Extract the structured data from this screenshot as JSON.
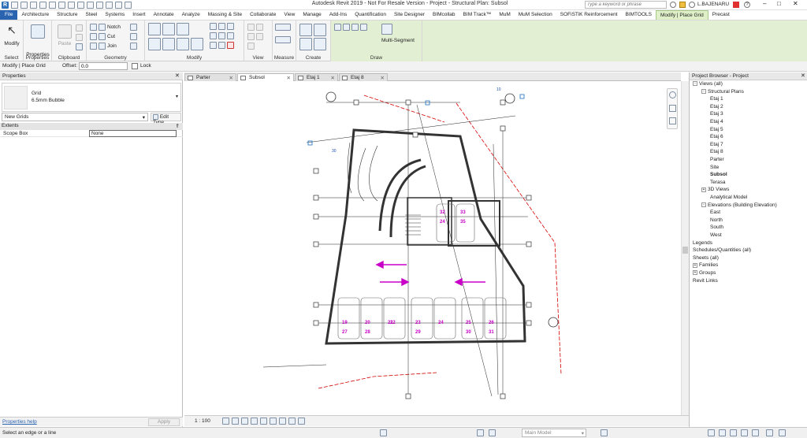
{
  "window": {
    "title": "Autodesk Revit 2019 - Not For Resale Version - Project - Structural Plan: Subsol"
  },
  "search": {
    "placeholder": "Type a keyword or phrase"
  },
  "user": {
    "name": "L.BAJENARU"
  },
  "tabs": [
    "File",
    "Architecture",
    "Structure",
    "Steel",
    "Systems",
    "Insert",
    "Annotate",
    "Analyze",
    "Massing & Site",
    "Collaborate",
    "View",
    "Manage",
    "Add-Ins",
    "Quantification",
    "Site Designer",
    "BIMcollab",
    "BIM Track™",
    "MuM",
    "MuM Selection",
    "SOFiSTiK Reinforcement",
    "BIMTOOLS",
    "Modify | Place Grid",
    "Precast"
  ],
  "ribbon": {
    "select": {
      "modify": "Modify",
      "label": "Select"
    },
    "properties": {
      "button": "Properties",
      "label": "Properties"
    },
    "clipboard": {
      "paste": "Paste",
      "label": "Clipboard"
    },
    "geometry": {
      "notch": "Notch",
      "cut": "Cut",
      "join": "Join",
      "label": "Geometry"
    },
    "modify_label": "Modify",
    "view_label": "View",
    "measure_label": "Measure",
    "create_label": "Create",
    "draw": {
      "multi_segment": "Multi-Segment",
      "label": "Draw"
    }
  },
  "options_bar": {
    "context": "Modify | Place Grid",
    "offset_label": "Offset:",
    "offset_value": "0.0",
    "lock_label": "Lock"
  },
  "properties_panel": {
    "title": "Properties",
    "family": "Grid",
    "type": "6.5mm Bubble",
    "selector": "New Grids",
    "edit_type": "Edit Type",
    "group": "Extents",
    "param_name": "Scope Box",
    "param_value": "None",
    "help": "Properties help",
    "apply": "Apply"
  },
  "view_tabs": [
    {
      "label": "Parter",
      "active": false
    },
    {
      "label": "Subsol",
      "active": true
    },
    {
      "label": "Etaj 1",
      "active": false
    },
    {
      "label": "Etaj 8",
      "active": false
    }
  ],
  "view_control": {
    "scale": "1 : 100"
  },
  "drawing": {
    "parking_numbers": [
      "32",
      "33",
      "24",
      "35",
      "19",
      "20",
      "21",
      "22",
      "23",
      "24",
      "25",
      "26",
      "27",
      "28",
      "29",
      "30",
      "31"
    ],
    "grid_labels": [
      "10",
      "30"
    ]
  },
  "project_browser": {
    "title": "Project Browser - Project",
    "items": [
      {
        "label": "Views (all)",
        "level": 0,
        "toggle": "-"
      },
      {
        "label": "Structural Plans",
        "level": 1,
        "toggle": "-"
      },
      {
        "label": "Etaj 1",
        "level": 2
      },
      {
        "label": "Etaj 2",
        "level": 2
      },
      {
        "label": "Etaj 3",
        "level": 2
      },
      {
        "label": "Etaj 4",
        "level": 2
      },
      {
        "label": "Etaj 5",
        "level": 2
      },
      {
        "label": "Etaj 6",
        "level": 2
      },
      {
        "label": "Etaj 7",
        "level": 2
      },
      {
        "label": "Etaj 8",
        "level": 2
      },
      {
        "label": "Parter",
        "level": 2
      },
      {
        "label": "Site",
        "level": 2
      },
      {
        "label": "Subsol",
        "level": 2,
        "selected": true
      },
      {
        "label": "Terasa",
        "level": 2
      },
      {
        "label": "3D Views",
        "level": 1,
        "toggle": "+"
      },
      {
        "label": "Analytical Model",
        "level": 2
      },
      {
        "label": "Elevations (Building Elevation)",
        "level": 1,
        "toggle": "-"
      },
      {
        "label": "East",
        "level": 2
      },
      {
        "label": "North",
        "level": 2
      },
      {
        "label": "South",
        "level": 2
      },
      {
        "label": "West",
        "level": 2
      },
      {
        "label": "Legends",
        "level": 0
      },
      {
        "label": "Schedules/Quantities (all)",
        "level": 0
      },
      {
        "label": "Sheets (all)",
        "level": 0
      },
      {
        "label": "Families",
        "level": 0,
        "toggle": "+"
      },
      {
        "label": "Groups",
        "level": 0,
        "toggle": "+"
      },
      {
        "label": "Revit Links",
        "level": 0
      }
    ]
  },
  "status_bar": {
    "message": "Select an edge or a line",
    "model": "Main Model"
  },
  "colors": {
    "accent": "#2a63b0",
    "active_tab": "#dff0c8",
    "magenta": "#c800c8",
    "dim_red": "#d40000"
  }
}
